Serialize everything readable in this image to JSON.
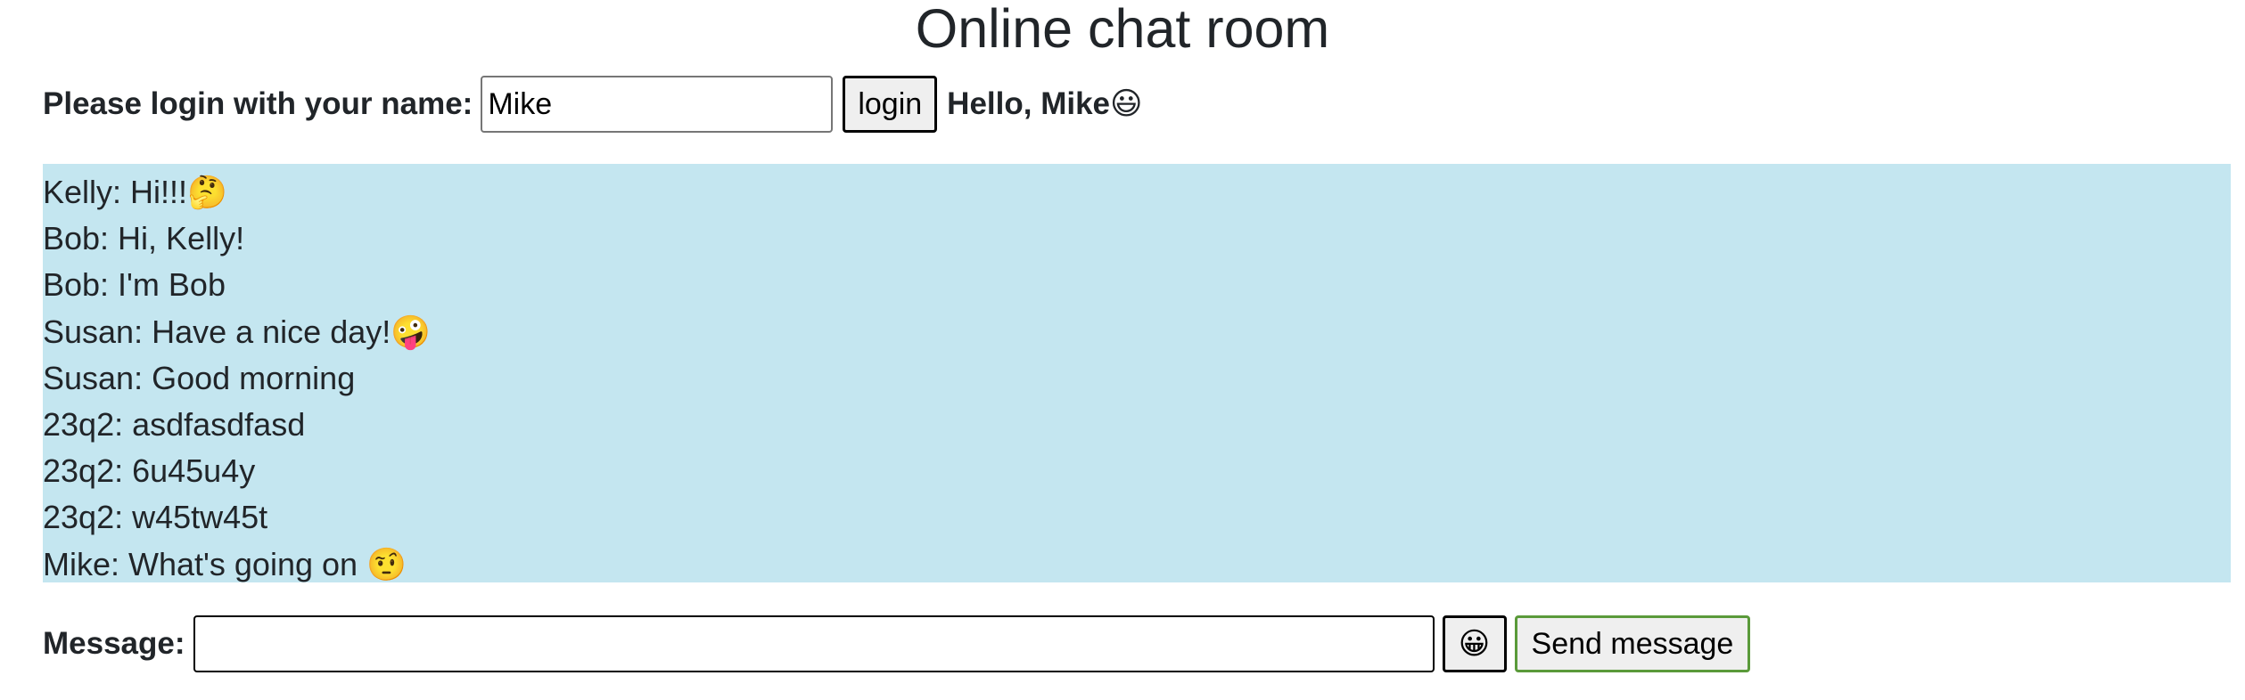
{
  "page": {
    "title": "Online chat room"
  },
  "login": {
    "label": "Please login with your name:",
    "name_value": "Mike",
    "button_label": "login",
    "greeting": "Hello, Mike",
    "greeting_emoji": "😃"
  },
  "chat": {
    "messages": [
      {
        "text": "Kelly: Hi!!!",
        "emoji": "🤔"
      },
      {
        "text": "Bob: Hi, Kelly!",
        "emoji": ""
      },
      {
        "text": "Bob: I'm Bob",
        "emoji": ""
      },
      {
        "text": "Susan: Have a nice day!",
        "emoji": "🤪"
      },
      {
        "text": "Susan: Good morning",
        "emoji": ""
      },
      {
        "text": "23q2: asdfasdfasd",
        "emoji": ""
      },
      {
        "text": "23q2: 6u45u4y",
        "emoji": ""
      },
      {
        "text": "23q2: w45tw45t",
        "emoji": ""
      },
      {
        "text": "Mike: What's going on ",
        "emoji": "🤨"
      }
    ]
  },
  "composer": {
    "label": "Message:",
    "message_value": "",
    "emoji_button": "😀",
    "send_label": "Send message"
  },
  "colors": {
    "chat_background": "#c4e6f0",
    "send_border": "#5a9a3a"
  }
}
